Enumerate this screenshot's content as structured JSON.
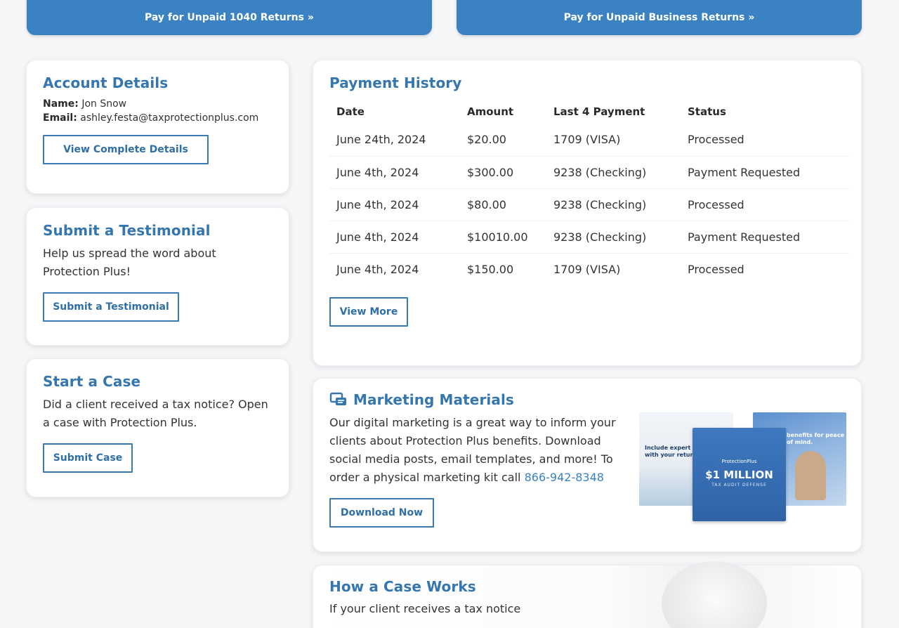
{
  "top_buttons": {
    "pay_1040": "Pay for Unpaid 1040 Returns",
    "pay_business": "Pay for Unpaid Business Returns"
  },
  "account": {
    "title": "Account Details",
    "name_label": "Name:",
    "name_value": "Jon Snow",
    "email_label": "Email:",
    "email_value": "ashley.festa@taxprotectionplus.com",
    "button": "View Complete Details"
  },
  "testimonial": {
    "title": "Submit a Testimonial",
    "text": "Help us spread the word about Protection Plus!",
    "button": "Submit a Testimonial"
  },
  "case": {
    "title": "Start a Case",
    "text": "Did a client received a tax notice? Open a case with Protection Plus.",
    "button": "Submit Case"
  },
  "payment_history": {
    "title": "Payment History",
    "columns": [
      "Date",
      "Amount",
      "Last 4 Payment",
      "Status"
    ],
    "rows": [
      [
        "June 24th, 2024",
        "$20.00",
        "1709 (VISA)",
        "Processed"
      ],
      [
        "June 4th, 2024",
        "$300.00",
        "9238 (Checking)",
        "Payment Requested"
      ],
      [
        "June 4th, 2024",
        "$80.00",
        "9238 (Checking)",
        "Processed"
      ],
      [
        "June 4th, 2024",
        "$10010.00",
        "9238 (Checking)",
        "Payment Requested"
      ],
      [
        "June 4th, 2024",
        "$150.00",
        "1709 (VISA)",
        "Processed"
      ]
    ],
    "button": "View More"
  },
  "marketing": {
    "title": "Marketing Materials",
    "text": "Our digital marketing is a great way to inform your clients about Protection Plus benefits. Download social media posts, email templates, and more! To order a physical marketing kit call",
    "phone": "866-942-8348",
    "button": "Download Now",
    "thumb_left_text": "Include expert defense with your return this year.",
    "thumb_center_logo": "ProtectionPlus",
    "thumb_center_big": "$1 MILLION",
    "thumb_center_small": "TAX AUDIT DEFENSE",
    "thumb_right_text": "benefits for peace of mind."
  },
  "how_case_works": {
    "title": "How a Case Works",
    "text": "If your client receives a tax notice"
  },
  "colors": {
    "brand_blue": "#3a82c1",
    "heading_blue": "#3476ad",
    "background": "#f5f6f8"
  },
  "icons": {
    "chevron": "double-chevron-right-icon",
    "marketing": "marketing-materials-icon"
  }
}
